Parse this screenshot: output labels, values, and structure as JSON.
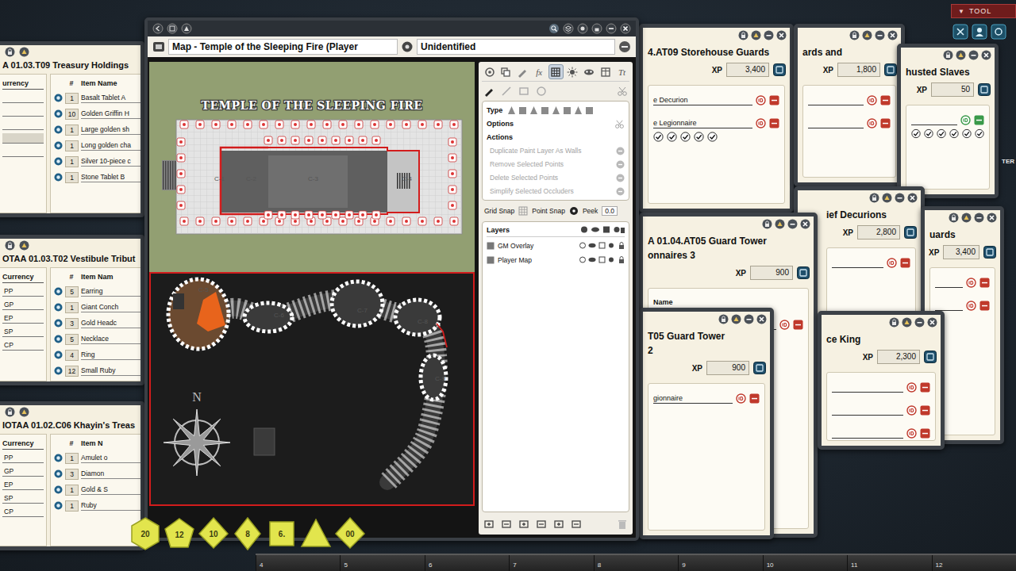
{
  "map_window": {
    "title": "Map - Temple of the Sleeping Fire (Player",
    "identity": "Unidentified",
    "map": {
      "heading": "TEMPLE OF THE SLEEPING FIRE",
      "compass": "N",
      "labels": [
        "C-1",
        "C-2",
        "C-3",
        "C-4",
        "C-5",
        "C-6",
        "C-7",
        "C-8",
        "C-9"
      ]
    },
    "tool_tabs": [
      {
        "kind": "paint",
        "selected": false
      },
      {
        "kind": "copy",
        "selected": false
      },
      {
        "kind": "draw",
        "selected": false
      },
      {
        "kind": "text",
        "label": "fx",
        "selected": false
      },
      {
        "kind": "grid",
        "selected": true
      },
      {
        "kind": "light",
        "selected": false
      },
      {
        "kind": "mask",
        "selected": false
      },
      {
        "kind": "table",
        "selected": false
      },
      {
        "kind": "text",
        "label": "Tt",
        "selected": false
      }
    ],
    "draw_tools": [
      {
        "kind": "pencil",
        "selected": true
      },
      {
        "kind": "line",
        "selected": false
      },
      {
        "kind": "rect",
        "selected": false
      },
      {
        "kind": "circle",
        "selected": false
      }
    ],
    "type_label": "Type",
    "options_label": "Options",
    "actions_label": "Actions",
    "actions": [
      {
        "label": "Duplicate Paint Layer As Walls",
        "disabled": true
      },
      {
        "label": "Remove Selected Points",
        "disabled": true
      },
      {
        "label": "Delete Selected Points",
        "disabled": true
      },
      {
        "label": "Simplify Selected Occluders",
        "disabled": true
      }
    ],
    "grid_snap": {
      "label": "Grid Snap",
      "on": false
    },
    "point_snap": {
      "label": "Point Snap",
      "on": true
    },
    "peek": {
      "label": "Peek",
      "value": "0.0"
    },
    "layers_label": "Layers",
    "layers": [
      {
        "name": "GM Overlay",
        "selected": false
      },
      {
        "name": "Player Map",
        "selected": false
      }
    ]
  },
  "treasure_windows": [
    {
      "title": "A 01.03.T09 Treasury Holdings",
      "currency_header": "urrency",
      "currencies": [
        {
          "code": "",
          "selected": false
        },
        {
          "code": "",
          "selected": false
        },
        {
          "code": "",
          "selected": false
        },
        {
          "code": "",
          "selected": true
        },
        {
          "code": "",
          "selected": false
        }
      ],
      "qty_header": "#",
      "item_header": "Item Name",
      "items": [
        {
          "qty": "1",
          "name": "Basalt Tablet A"
        },
        {
          "qty": "10",
          "name": "Golden Griffin H"
        },
        {
          "qty": "1",
          "name": "Large golden sh"
        },
        {
          "qty": "1",
          "name": "Long golden cha"
        },
        {
          "qty": "1",
          "name": "Silver 10-piece c"
        },
        {
          "qty": "1",
          "name": "Stone Tablet B"
        }
      ]
    },
    {
      "title": "OTAA 01.03.T02 Vestibule Tribut",
      "currency_header": "Currency",
      "currencies": [
        {
          "code": "PP",
          "selected": false
        },
        {
          "code": "GP",
          "selected": false
        },
        {
          "code": "EP",
          "selected": false
        },
        {
          "code": "SP",
          "selected": false
        },
        {
          "code": "CP",
          "selected": false
        }
      ],
      "qty_header": "#",
      "item_header": "Item Nam",
      "items": [
        {
          "qty": "5",
          "name": "Earring"
        },
        {
          "qty": "1",
          "name": "Giant Conch"
        },
        {
          "qty": "3",
          "name": "Gold Headc"
        },
        {
          "qty": "5",
          "name": "Necklace"
        },
        {
          "qty": "4",
          "name": "Ring"
        },
        {
          "qty": "12",
          "name": "Small Ruby"
        }
      ]
    },
    {
      "title": "IOTAA 01.02.C06 Khayin's Treas",
      "currency_header": "Currency",
      "currencies": [
        {
          "code": "PP",
          "selected": false
        },
        {
          "code": "GP",
          "selected": false
        },
        {
          "code": "EP",
          "selected": false
        },
        {
          "code": "SP",
          "selected": false
        },
        {
          "code": "CP",
          "selected": false
        }
      ],
      "qty_header": "#",
      "item_header": "Item N",
      "items": [
        {
          "qty": "1",
          "name": "Amulet o"
        },
        {
          "qty": "3",
          "name": "Diamon"
        },
        {
          "qty": "1",
          "name": "Gold & S"
        },
        {
          "qty": "1",
          "name": "Ruby"
        }
      ]
    }
  ],
  "encounter_windows": [
    {
      "title": [
        "4.AT09 Storehouse Guards"
      ],
      "xp_label": "XP",
      "xp": "3,400",
      "rows": [
        {
          "name": "e Decurion",
          "tokens": [],
          "color": "#c0392b"
        },
        {
          "name": "e Legionnaire",
          "tokens": [
            true,
            true,
            true,
            true,
            true
          ],
          "color": "#c0392b"
        }
      ]
    },
    {
      "title": [
        "ards and"
      ],
      "xp_label": "XP",
      "xp": "1,800",
      "rows": [
        {
          "name": "",
          "tokens": [],
          "color": "#c0392b"
        },
        {
          "name": "",
          "tokens": [],
          "color": "#c0392b"
        }
      ]
    },
    {
      "title": [
        "husted Slaves"
      ],
      "xp_label": "XP",
      "xp": "50",
      "rows": [
        {
          "name": "",
          "tokens": [
            true,
            true,
            true,
            true,
            true,
            true
          ],
          "color": "#3a9a4a"
        }
      ]
    },
    {
      "title": [
        "ief Decurions"
      ],
      "xp_label": "XP",
      "xp": "2,800",
      "rows": [
        {
          "name": "",
          "tokens": [],
          "color": "#c0392b"
        }
      ]
    },
    {
      "title": [
        "uards"
      ],
      "xp_label": "XP",
      "xp": "3,400",
      "rows": [
        {
          "name": "",
          "tokens": [],
          "color": "#c0392b"
        },
        {
          "name": "",
          "tokens": [],
          "color": "#c0392b"
        }
      ]
    },
    {
      "title": [
        "A 01.04.AT05 Guard Tower",
        "onnaires 3"
      ],
      "xp_label": "XP",
      "xp": "900",
      "name_header": "Name",
      "rows": [
        {
          "name": "",
          "tokens": [],
          "color": "#c0392b"
        }
      ]
    },
    {
      "title": [
        "ce King"
      ],
      "xp_label": "XP",
      "xp": "2,300",
      "rows": [
        {
          "name": "",
          "tokens": [],
          "color": "#c0392b"
        },
        {
          "name": "",
          "tokens": [],
          "color": "#c0392b"
        },
        {
          "name": "",
          "tokens": [],
          "color": "#c0392b"
        }
      ]
    },
    {
      "title": [
        "T05 Guard Tower",
        "2"
      ],
      "xp_label": "XP",
      "xp": "900",
      "rows": [
        {
          "name": "gionnaire",
          "tokens": [],
          "color": "#c0392b"
        }
      ]
    }
  ],
  "dice": [
    {
      "kind": "d20",
      "label": "20"
    },
    {
      "kind": "d12",
      "label": "12"
    },
    {
      "kind": "d10",
      "label": "10"
    },
    {
      "kind": "d8",
      "label": "8"
    },
    {
      "kind": "d6",
      "label": "6."
    },
    {
      "kind": "d4"
    },
    {
      "kind": "d100",
      "label": "00"
    }
  ],
  "tool_menu": {
    "arrow": "▼",
    "label": "TOOL"
  },
  "side_tab": "TER",
  "hotbar": [
    "4",
    "5",
    "6",
    "7",
    "8",
    "9",
    "10",
    "11",
    "12"
  ]
}
